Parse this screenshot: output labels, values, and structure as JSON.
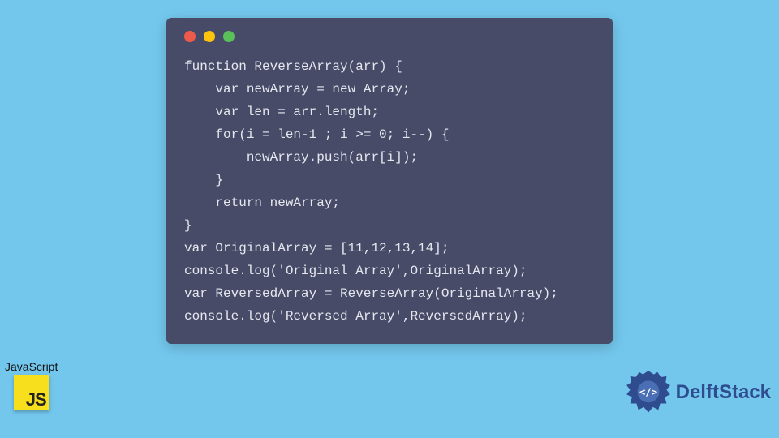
{
  "window": {
    "dot_red": "close",
    "dot_yellow": "minimize",
    "dot_green": "zoom"
  },
  "code": {
    "lines": [
      "function ReverseArray(arr) {",
      "    var newArray = new Array;",
      "    var len = arr.length;",
      "    for(i = len-1 ; i >= 0; i--) {",
      "        newArray.push(arr[i]);",
      "    }",
      "    return newArray;",
      "}",
      "var OriginalArray = [11,12,13,14];",
      "console.log('Original Array',OriginalArray);",
      "var ReversedArray = ReverseArray(OriginalArray);",
      "console.log('Reversed Array',ReversedArray);"
    ]
  },
  "js_badge": {
    "label": "JavaScript",
    "logo_text": "JS"
  },
  "brand": {
    "name": "DelftStack"
  }
}
